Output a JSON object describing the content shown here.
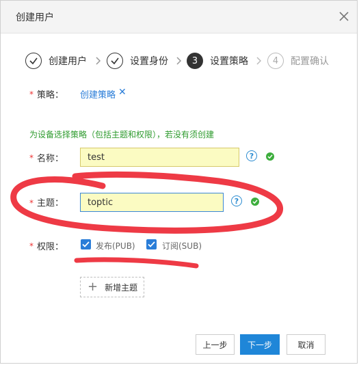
{
  "dialog": {
    "title": "创建用户"
  },
  "steps": [
    {
      "index": "1",
      "label": "创建用户",
      "state": "done"
    },
    {
      "index": "2",
      "label": "设置身份",
      "state": "done"
    },
    {
      "index": "3",
      "label": "设置策略",
      "state": "active"
    },
    {
      "index": "4",
      "label": "配置确认",
      "state": "pending"
    }
  ],
  "required_mark": "*",
  "policy": {
    "label": "策略：",
    "link": "创建策略",
    "remove": "✕"
  },
  "hint": "为设备选择策略（包括主题和权限），若没有须创建",
  "name_field": {
    "label": "名称：",
    "value": "test"
  },
  "topic_field": {
    "label": "主题：",
    "value": "toptic"
  },
  "perm": {
    "label": "权限：",
    "publish": "发布(PUB)",
    "subscribe": "订阅(SUB)"
  },
  "add_topic": {
    "plus": "+",
    "label": "新增主题"
  },
  "buttons": {
    "prev": "上一步",
    "next": "下一步",
    "cancel": "取消"
  },
  "help_glyph": "?",
  "colors": {
    "accent": "#1f86d8",
    "success": "#3dae3d",
    "required": "#e33333",
    "annotation": "#ee3a45"
  }
}
